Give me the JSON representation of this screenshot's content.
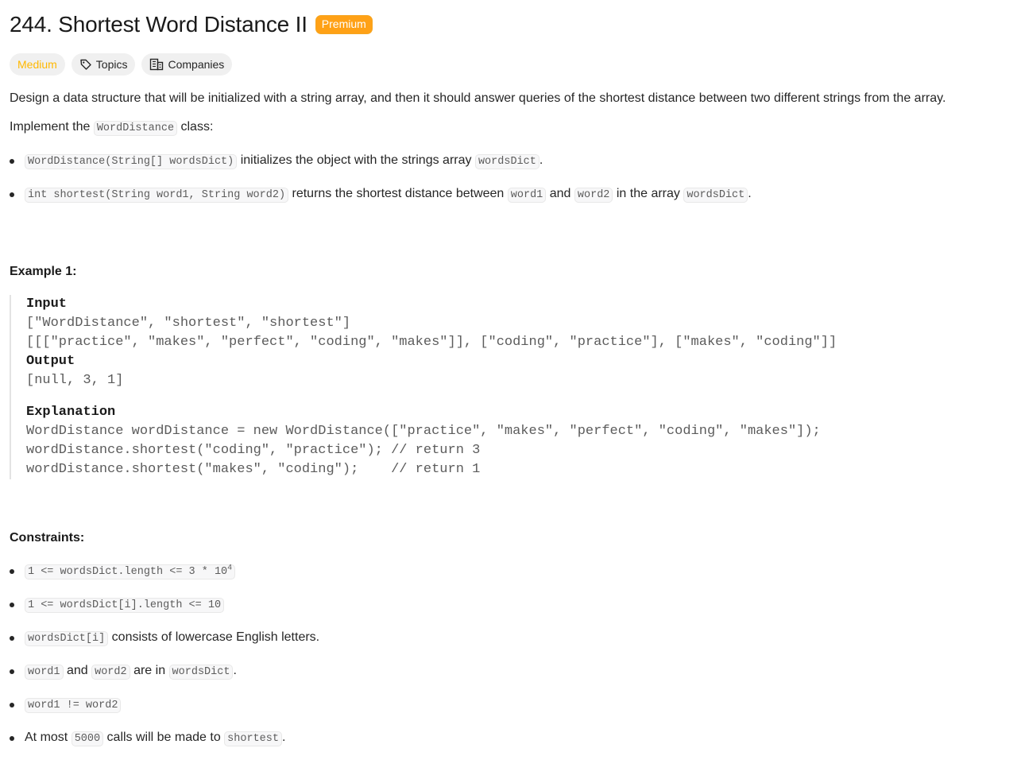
{
  "problem": {
    "title": "244. Shortest Word Distance II",
    "premium_label": "Premium",
    "tags": {
      "difficulty": "Medium",
      "topics": "Topics",
      "companies": "Companies"
    }
  },
  "description": {
    "intro": "Design a data structure that will be initialized with a string array, and then it should answer queries of the shortest distance between two different strings from the array.",
    "implement_pre": "Implement the ",
    "implement_code": "WordDistance",
    "implement_post": " class:",
    "bullets": [
      {
        "code": "WordDistance(String[] wordsDict)",
        "text1": " initializes the object with the strings array ",
        "code2": "wordsDict",
        "text2": "."
      },
      {
        "code": "int shortest(String word1, String word2)",
        "text1": " returns the shortest distance between ",
        "code2": "word1",
        "text2": " and ",
        "code3": "word2",
        "text3": " in the array ",
        "code4": "wordsDict",
        "text4": "."
      }
    ]
  },
  "example": {
    "heading": "Example 1:",
    "input_label": "Input",
    "input_line1": "[\"WordDistance\", \"shortest\", \"shortest\"]",
    "input_line2": "[[[\"practice\", \"makes\", \"perfect\", \"coding\", \"makes\"]], [\"coding\", \"practice\"], [\"makes\", \"coding\"]]",
    "output_label": "Output",
    "output_line": "[null, 3, 1]",
    "explanation_label": "Explanation",
    "explanation_lines": [
      "WordDistance wordDistance = new WordDistance([\"practice\", \"makes\", \"perfect\", \"coding\", \"makes\"]);",
      "wordDistance.shortest(\"coding\", \"practice\"); // return 3",
      "wordDistance.shortest(\"makes\", \"coding\");    // return 1"
    ]
  },
  "constraints": {
    "heading": "Constraints:",
    "c1_code": "1 <= wordsDict.length <= 3 * 10",
    "c1_sup": "4",
    "c2_code": "1 <= wordsDict[i].length <= 10",
    "c3_code": "wordsDict[i]",
    "c3_text": " consists of lowercase English letters.",
    "c4_code1": "word1",
    "c4_text1": " and ",
    "c4_code2": "word2",
    "c4_text2": " are in ",
    "c4_code3": "wordsDict",
    "c4_text3": ".",
    "c5_code": "word1 != word2",
    "c6_text1": "At most ",
    "c6_code1": "5000",
    "c6_text2": " calls will be made to ",
    "c6_code2": "shortest",
    "c6_text3": "."
  }
}
